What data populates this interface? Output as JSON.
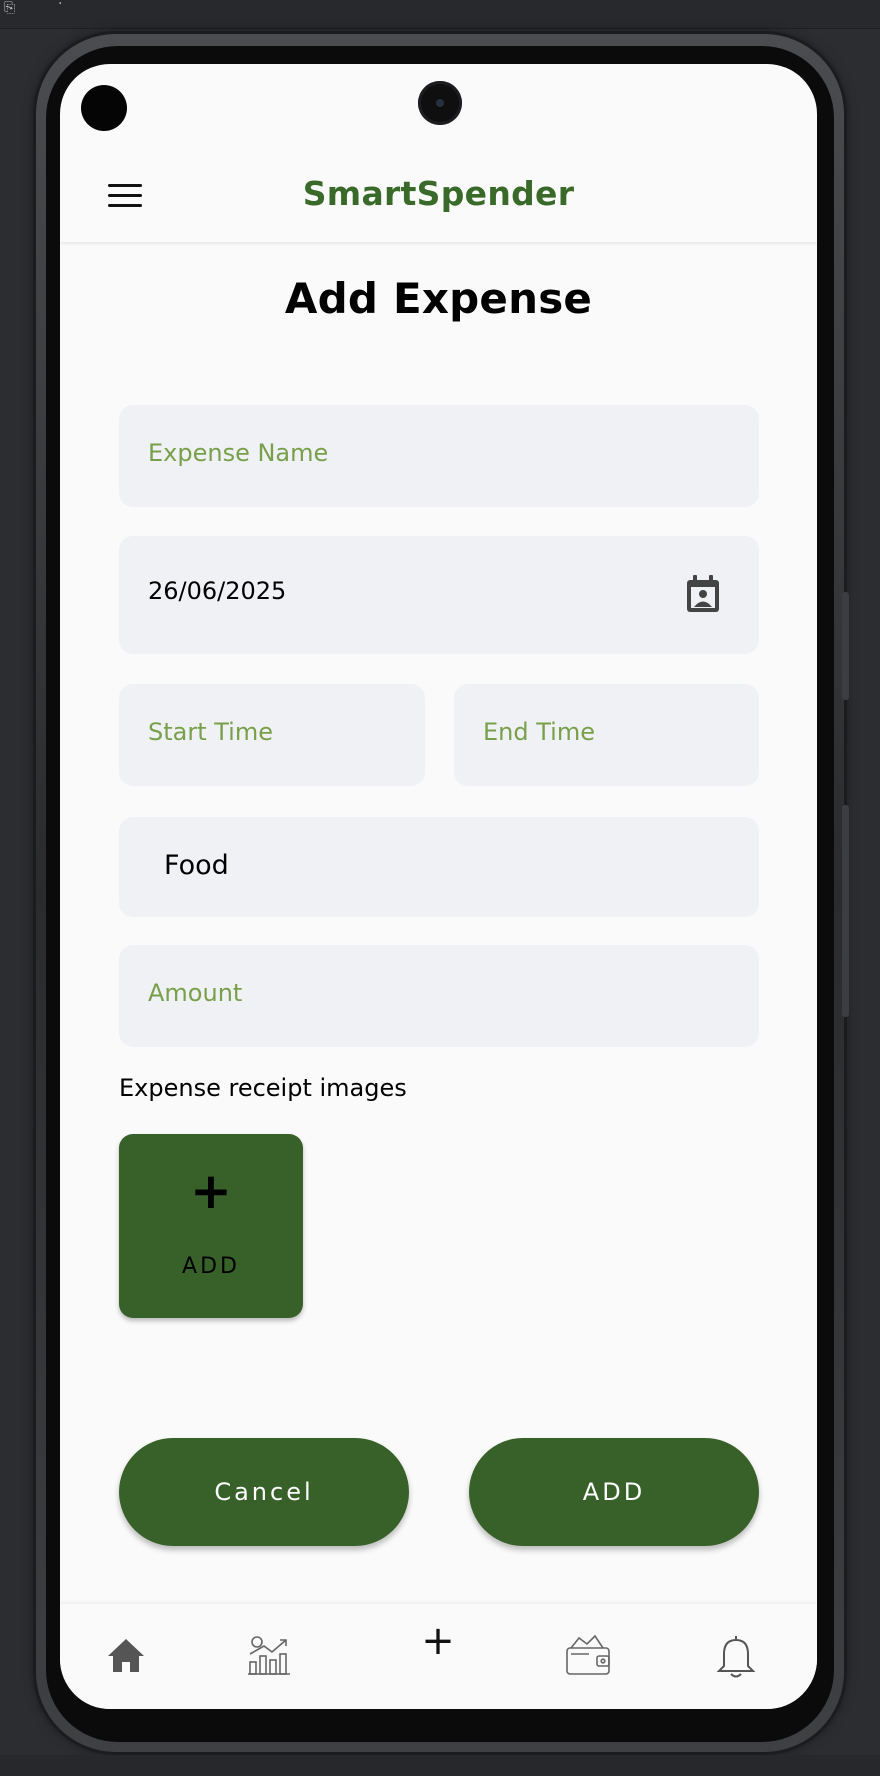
{
  "app": {
    "title": "SmartSpender"
  },
  "page": {
    "title": "Add Expense"
  },
  "form": {
    "expense_name_placeholder": "Expense Name",
    "date_value": "26/06/2025",
    "start_time_placeholder": "Start Time",
    "end_time_placeholder": "End Time",
    "category_value": "Food",
    "amount_placeholder": "Amount"
  },
  "receipts": {
    "label": "Expense receipt images",
    "add_label": "ADD",
    "add_symbol": "+"
  },
  "actions": {
    "cancel_label": "Cancel",
    "add_label": "ADD"
  },
  "nav": {
    "items": [
      {
        "icon": "home-icon"
      },
      {
        "icon": "analytics-icon"
      },
      {
        "icon": "plus-icon",
        "symbol": "+"
      },
      {
        "icon": "wallet-icon"
      },
      {
        "icon": "bell-icon"
      }
    ]
  },
  "colors": {
    "brand_green": "#3a6a29",
    "button_green": "#38612a",
    "placeholder_green": "#78a04a",
    "field_bg": "#f0f1f5"
  }
}
